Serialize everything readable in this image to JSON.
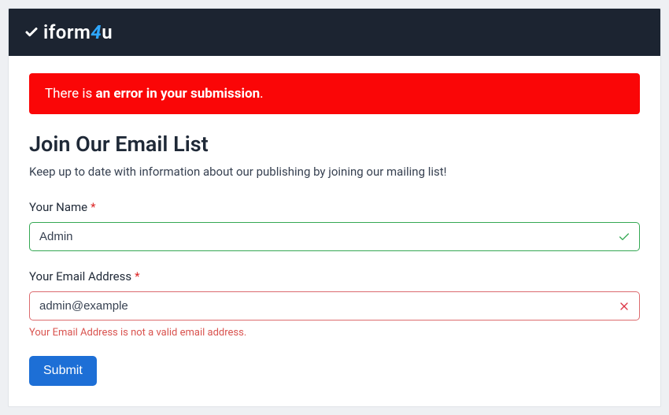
{
  "brand": {
    "part1": "iform",
    "part2": "4",
    "part3": "u"
  },
  "alert": {
    "prefix": "There is ",
    "strong": "an error in your submission",
    "suffix": "."
  },
  "page": {
    "title": "Join Our Email List",
    "subtitle": "Keep up to date with information about our publishing by joining our mailing list!"
  },
  "form": {
    "name": {
      "label": "Your Name",
      "required": "*",
      "value": "Admin"
    },
    "email": {
      "label": "Your Email Address",
      "required": "*",
      "value": "admin@example",
      "error": "Your Email Address is not a valid email address."
    },
    "submit_label": "Submit"
  }
}
